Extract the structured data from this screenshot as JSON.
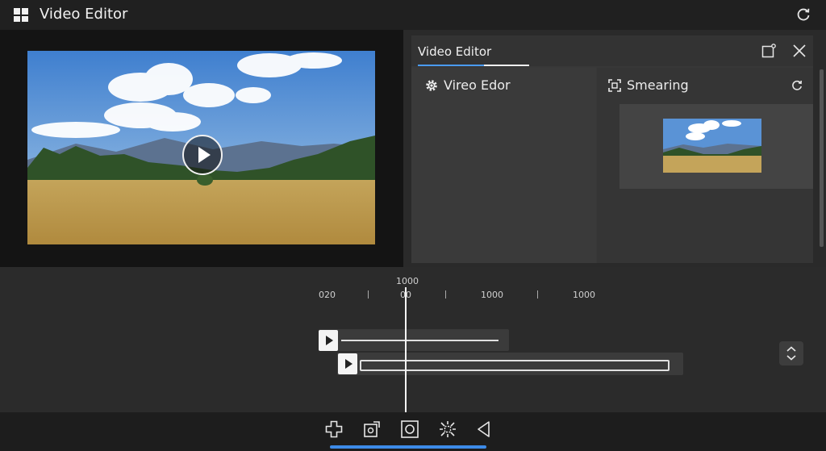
{
  "window": {
    "title": "Video Editor"
  },
  "panel": {
    "tab_label": "Video Editor",
    "left_item_label": "Vireo Edor",
    "right_item_label": "Smearing"
  },
  "timeline": {
    "ruler_top_label": "1000",
    "ruler_labels": [
      "020",
      "00",
      "1000",
      "1000"
    ]
  },
  "icons": {
    "window_logo": "windows-logo-icon",
    "refresh": "refresh-icon",
    "play": "play-icon",
    "popout": "popout-icon",
    "close": "close-icon",
    "gear": "gear-icon",
    "crop": "crop-icon",
    "updown": "chevron-updown-icon",
    "add_clip": "add-clip-icon",
    "rotate": "rotate-icon",
    "snapshot": "snapshot-icon",
    "effects": "effects-icon",
    "back": "back-icon"
  },
  "colors": {
    "accent": "#3d8be8",
    "background": "#2a2a2a"
  }
}
